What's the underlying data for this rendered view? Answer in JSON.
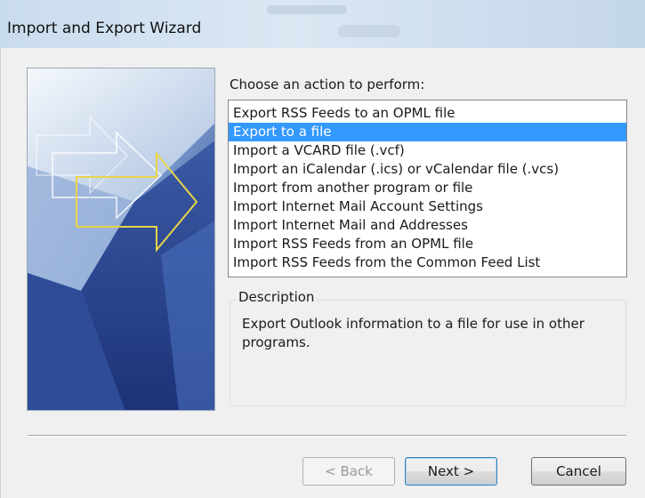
{
  "window": {
    "title": "Import and Export Wizard"
  },
  "main": {
    "instruction": "Choose an action to perform:",
    "actions": [
      {
        "label": "Export RSS Feeds to an OPML file",
        "selected": false
      },
      {
        "label": "Export to a file",
        "selected": true
      },
      {
        "label": "Import a VCARD file (.vcf)",
        "selected": false
      },
      {
        "label": "Import an iCalendar (.ics) or vCalendar file (.vcs)",
        "selected": false
      },
      {
        "label": "Import from another program or file",
        "selected": false
      },
      {
        "label": "Import Internet Mail Account Settings",
        "selected": false
      },
      {
        "label": "Import Internet Mail and Addresses",
        "selected": false
      },
      {
        "label": "Import RSS Feeds from an OPML file",
        "selected": false
      },
      {
        "label": "Import RSS Feeds from the Common Feed List",
        "selected": false
      }
    ],
    "description": {
      "legend": "Description",
      "text": "Export Outlook information to a file for use in other programs."
    }
  },
  "buttons": {
    "back": "< Back",
    "next": "Next >",
    "cancel": "Cancel"
  },
  "colors": {
    "selection": "#3399ff",
    "art_blue": "#3f62a8",
    "arrow_yellow": "#e8d44a"
  },
  "icons": {
    "wizard_art": "import-export-arrows-art"
  }
}
